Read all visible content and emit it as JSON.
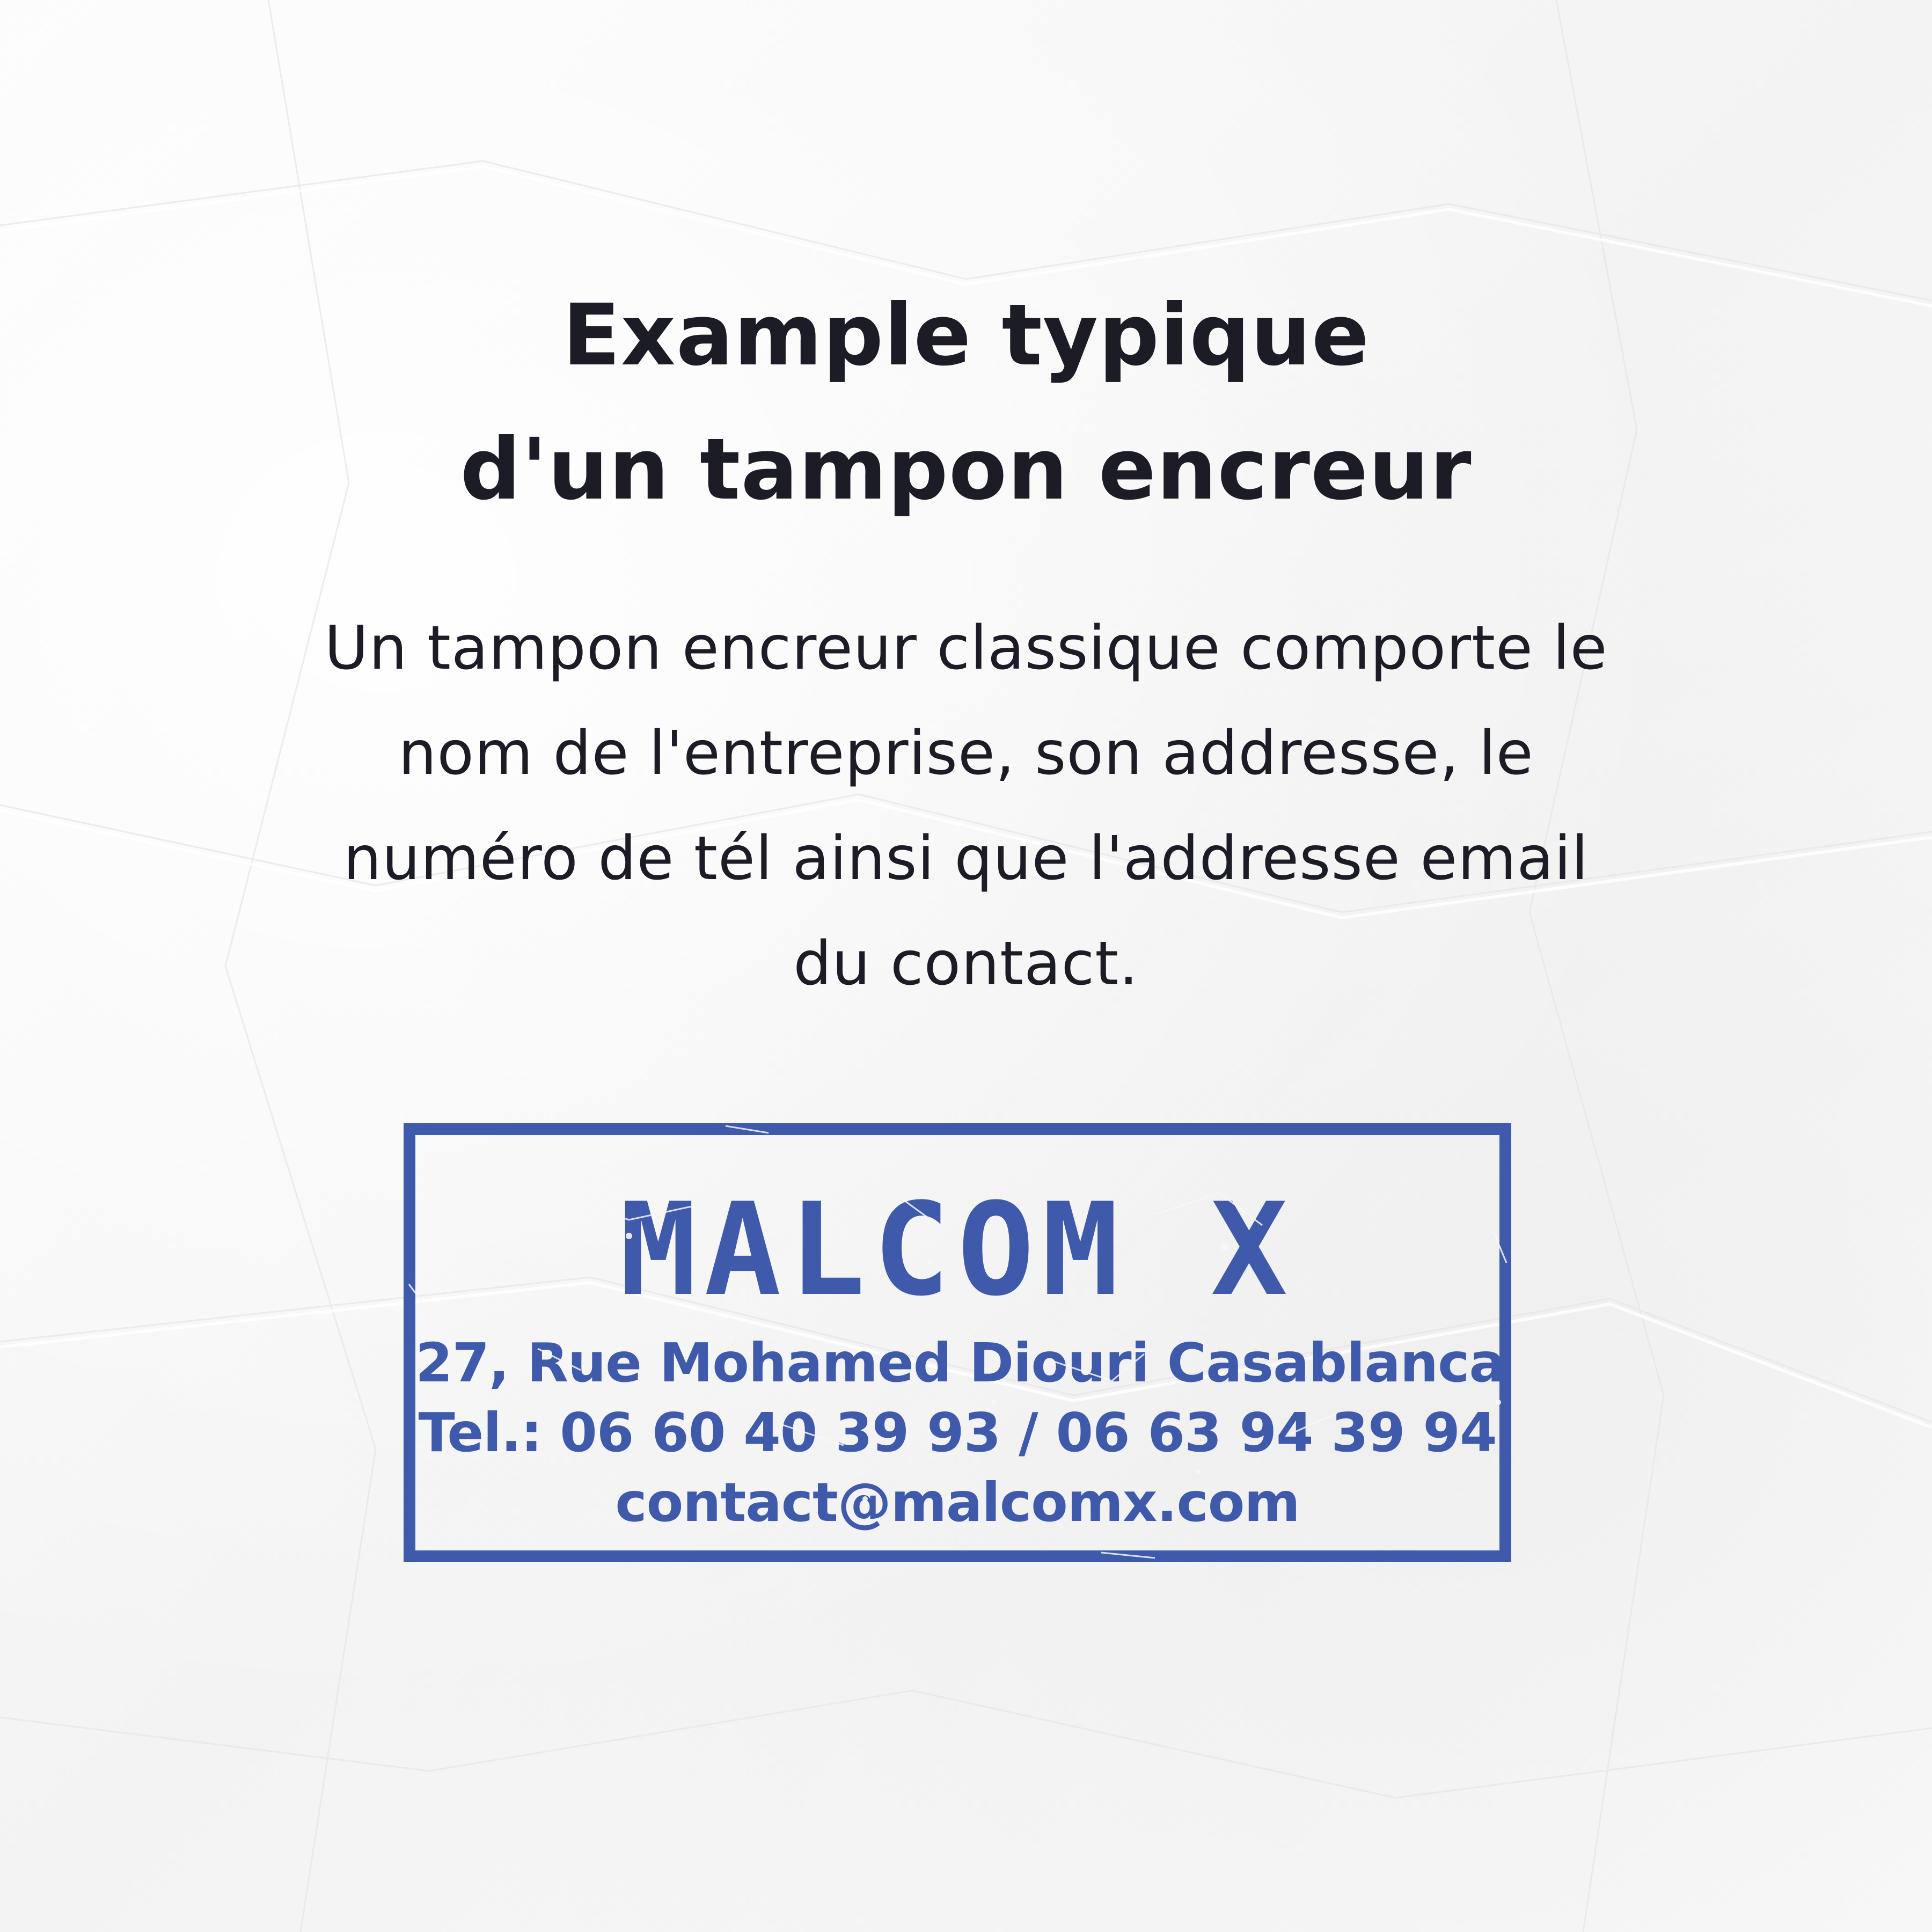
{
  "heading": {
    "line1": "Example typique",
    "line2": "d'un tampon encreur"
  },
  "description": {
    "line1": "Un tampon encreur classique comporte le",
    "line2": "nom de l'entreprise, son addresse, le",
    "line3": "numéro de tél ainsi que l'addresse email",
    "line4": "du contact."
  },
  "stamp": {
    "name": "MALCOM X",
    "address": "27, Rue Mohamed Diouri Casablanca",
    "phone": "Tel.: 06 60 40 39 93 / 06 63 94 39 94",
    "email": "contact@malcomx.com",
    "ink_color": "#3f5aab"
  },
  "colors": {
    "text": "#1b1c26",
    "background": "#f9f9f9"
  }
}
